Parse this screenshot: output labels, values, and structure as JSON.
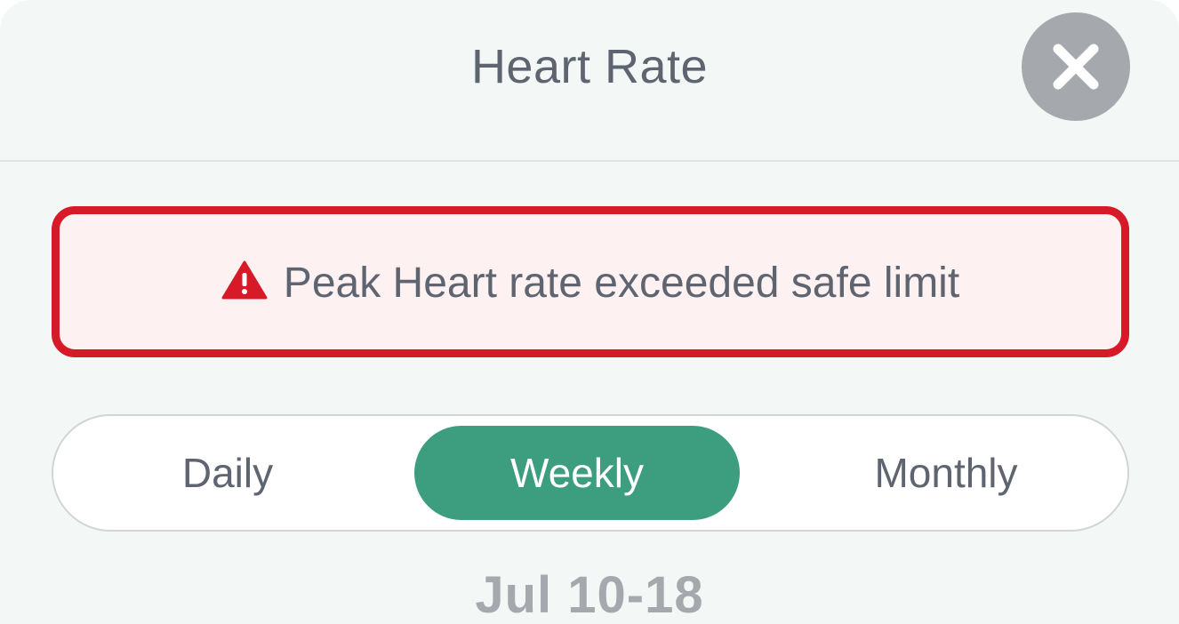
{
  "header": {
    "title": "Heart Rate",
    "close_icon": "close-icon"
  },
  "alert": {
    "icon": "warning-triangle-icon",
    "message": "Peak Heart rate exceeded safe limit",
    "color": "#d71a27"
  },
  "period_selector": {
    "options": [
      "Daily",
      "Weekly",
      "Monthly"
    ],
    "selected": "Weekly",
    "selected_color": "#3d9d7f"
  },
  "date_range": "Jul 10-18"
}
